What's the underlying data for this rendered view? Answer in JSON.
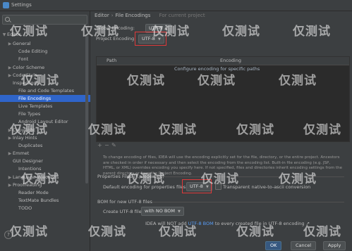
{
  "window": {
    "title": "Settings"
  },
  "sidebar": {
    "search_placeholder": "",
    "items": [
      {
        "label": "Editor",
        "arrow": "▼",
        "kind": "section"
      },
      {
        "label": "General",
        "arrow": "▶"
      },
      {
        "label": "Code Editing",
        "arrow": ""
      },
      {
        "label": "Font",
        "arrow": ""
      },
      {
        "label": "Color Scheme",
        "arrow": "▶"
      },
      {
        "label": "Code Style",
        "arrow": "▶"
      },
      {
        "label": "Inspections",
        "arrow": ""
      },
      {
        "label": "File and Code Templates",
        "arrow": ""
      },
      {
        "label": "File Encodings",
        "arrow": "",
        "selected": true
      },
      {
        "label": "Live Templates",
        "arrow": ""
      },
      {
        "label": "File Types",
        "arrow": ""
      },
      {
        "label": "Android Layout Editor",
        "arrow": ""
      },
      {
        "label": "Copyright",
        "arrow": "▶"
      },
      {
        "label": "Inlay Hints",
        "arrow": "▶"
      },
      {
        "label": "Duplicates",
        "arrow": ""
      },
      {
        "label": "Emmet",
        "arrow": "▶"
      },
      {
        "label": "GUI Designer",
        "arrow": ""
      },
      {
        "label": "Intentions",
        "arrow": ""
      },
      {
        "label": "Language Injections",
        "arrow": "▶"
      },
      {
        "label": "Proofreading",
        "arrow": "▶"
      },
      {
        "label": "Reader Mode",
        "arrow": ""
      },
      {
        "label": "TextMate Bundles",
        "arrow": ""
      },
      {
        "label": "TODO",
        "arrow": ""
      }
    ]
  },
  "main": {
    "breadcrumb": {
      "parent": "Editor",
      "separator": "›",
      "current": "File Encodings",
      "hint": "For current project"
    },
    "global_encoding_label": "Global Encoding:",
    "global_encoding_value": "UTF-8",
    "project_encoding_label": "Project Encoding:",
    "project_encoding_value": "UTF-8",
    "table": {
      "col_path": "Path",
      "col_encoding": "Encoding",
      "row_text": "Configure encoding for specific paths"
    },
    "toolbar": {
      "add": "+",
      "remove": "−",
      "edit": "✎"
    },
    "description": "To change encoding of files, IDEA will use the encoding explicitly set for the file, directory, or the entire project. Ancestors are checked in order if necessary and then select the encoding from the encoding list. Built-in file encoding (e.g. JSP, HTML, or XML) overrides encoding you specify here. If not specified, files and directories inherit encoding settings from the parent directory or from the Project Encoding.",
    "properties_section": "Properties Files (*.properties)",
    "default_props_label": "Default encoding for properties files:",
    "default_props_value": "UTF-8",
    "transparent_label": "Transparent native-to-ascii conversion",
    "bom_section": "BOM for new UTF-8 files",
    "create_bom_label": "Create UTF-8 files:",
    "create_bom_value": "with NO BOM",
    "bom_note_prefix": "IDEA will NOT add",
    "bom_note_link": "UTF-8 BOM",
    "bom_note_suffix": "to every created file in UTF-8 encoding ↗"
  },
  "buttons": {
    "ok": "OK",
    "cancel": "Cancel",
    "apply": "Apply"
  },
  "watermark": "仅测试"
}
